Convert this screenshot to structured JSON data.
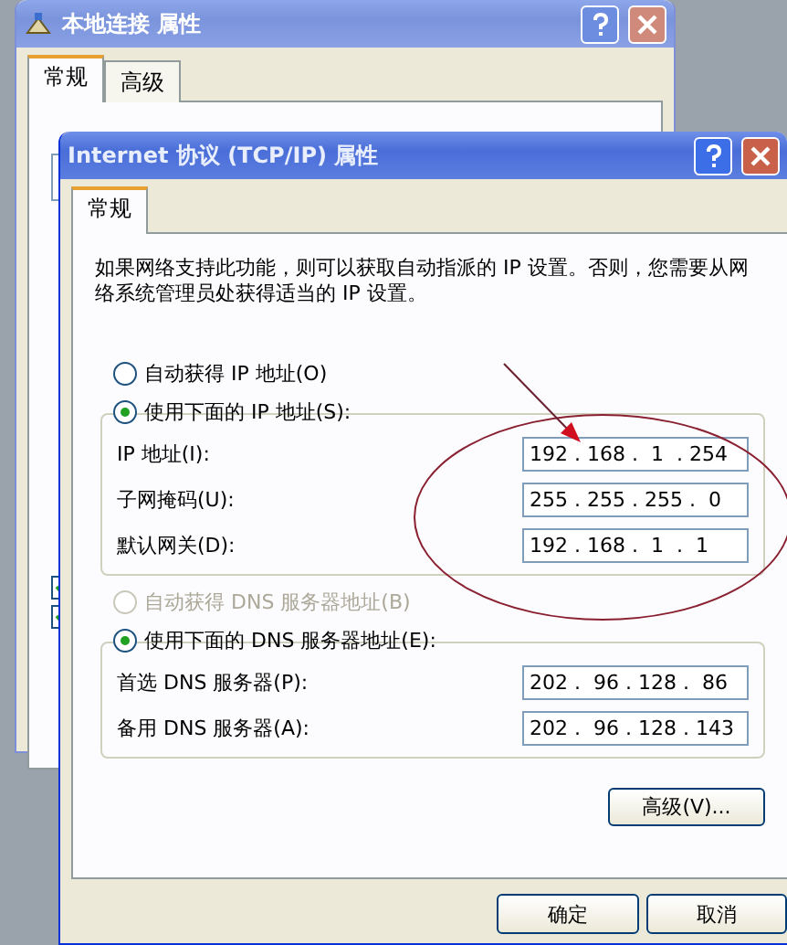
{
  "background_window": {
    "title": "本地连接 属性",
    "tabs": [
      {
        "label": "常规",
        "selected": true
      },
      {
        "label": "高级",
        "selected": false
      }
    ],
    "checkboxes": [
      {
        "checked": true
      },
      {
        "checked": true
      }
    ]
  },
  "dialog": {
    "title": "Internet 协议 (TCP/IP) 属性",
    "tabs": [
      {
        "label": "常规",
        "selected": true
      }
    ],
    "description": "如果网络支持此功能，则可以获取自动指派的 IP 设置。否则，您需要从网络系统管理员处获得适当的 IP 设置。",
    "ip_options": [
      {
        "label": "自动获得 IP 地址(O)",
        "selected": false,
        "disabled": false
      },
      {
        "label": "使用下面的 IP 地址(S):",
        "selected": true,
        "disabled": false
      }
    ],
    "ip_fields": [
      {
        "label": "IP 地址(I):",
        "value": "192 . 168 .  1  . 254"
      },
      {
        "label": "子网掩码(U):",
        "value": "255 . 255 . 255 .  0"
      },
      {
        "label": "默认网关(D):",
        "value": "192 . 168 .  1  .  1"
      }
    ],
    "dns_options": [
      {
        "label": "自动获得 DNS 服务器地址(B)",
        "selected": false,
        "disabled": true
      },
      {
        "label": "使用下面的 DNS 服务器地址(E):",
        "selected": true,
        "disabled": false
      }
    ],
    "dns_fields": [
      {
        "label": "首选 DNS 服务器(P):",
        "value": "202 .  96 . 128 .  86"
      },
      {
        "label": "备用 DNS 服务器(A):",
        "value": "202 .  96 . 128 . 143"
      }
    ],
    "advanced_button": "高级(V)...",
    "buttons": [
      "确定",
      "取消"
    ]
  }
}
